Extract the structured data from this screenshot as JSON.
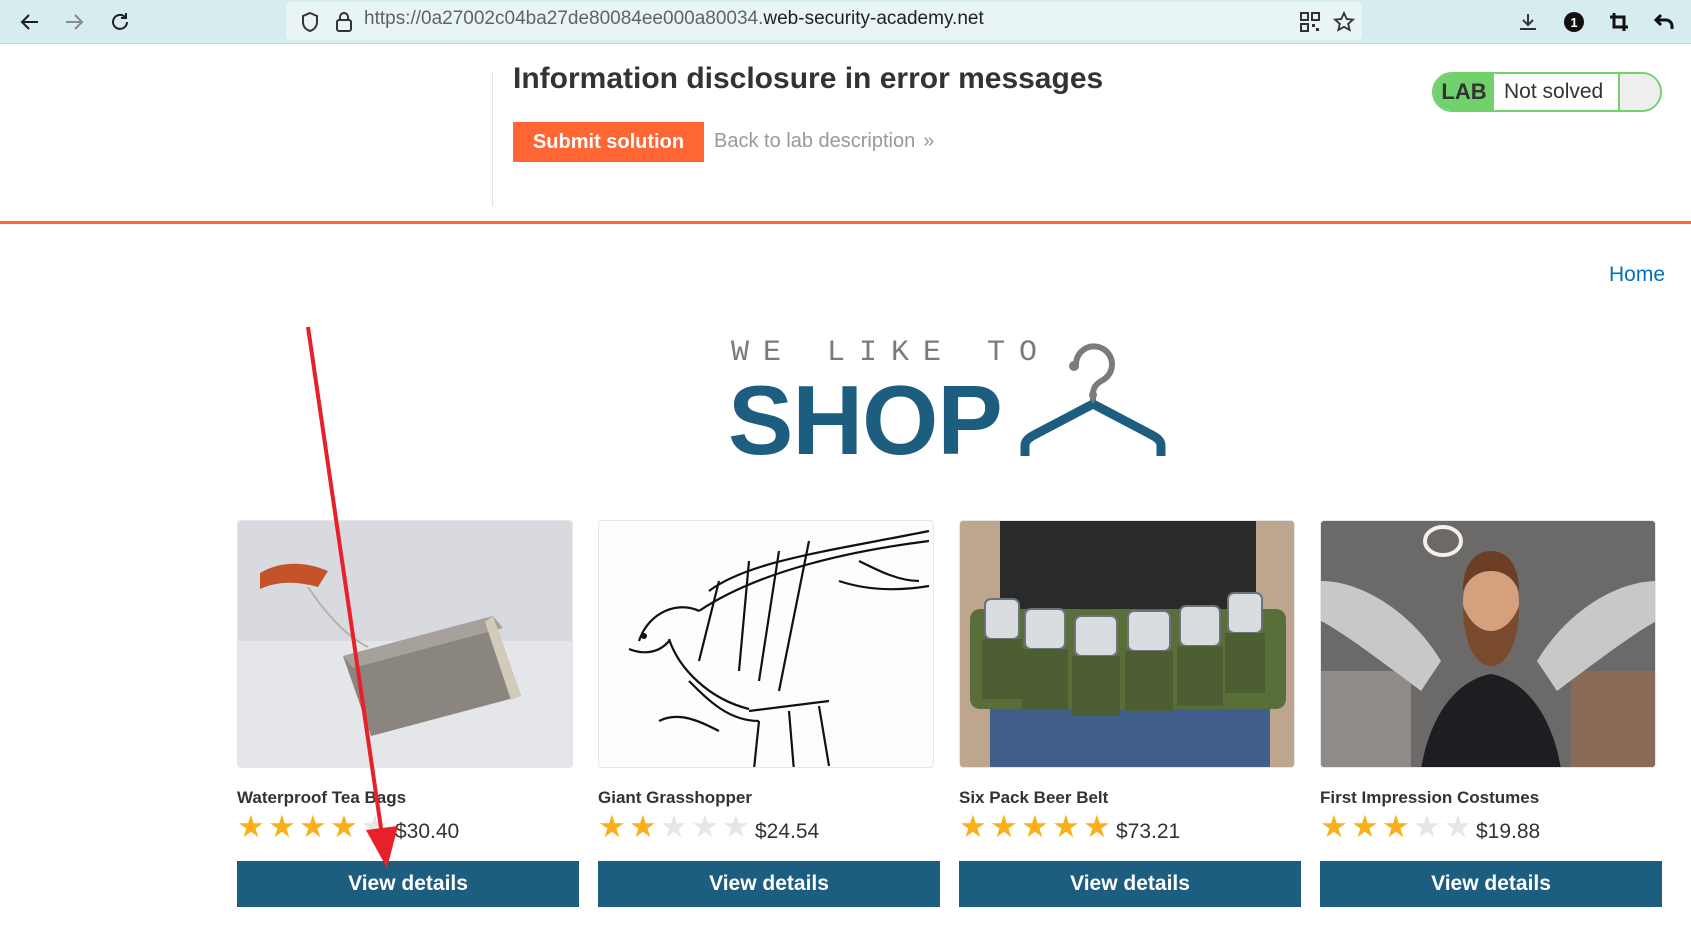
{
  "browser": {
    "url_prefix": "https://0a27002c04ba27de80084ee000a80034.",
    "url_host": "web-security-academy.net"
  },
  "lab": {
    "title": "Information disclosure in error messages",
    "submit_label": "Submit solution",
    "back_label": "Back to lab description",
    "back_chevron": "»",
    "status_badge": "LAB",
    "status_text": "Not solved"
  },
  "nav": {
    "home_label": "Home"
  },
  "logo": {
    "top_text": "WE LIKE TO",
    "main_text": "SHOP"
  },
  "products": [
    {
      "name": "Waterproof Tea Bags",
      "rating": 4,
      "price": "$30.40",
      "button": "View details"
    },
    {
      "name": "Giant Grasshopper",
      "rating": 2,
      "price": "$24.54",
      "button": "View details"
    },
    {
      "name": "Six Pack Beer Belt",
      "rating": 5,
      "price": "$73.21",
      "button": "View details"
    },
    {
      "name": "First Impression Costumes",
      "rating": 3,
      "price": "$19.88",
      "button": "View details"
    }
  ],
  "colors": {
    "accent_orange": "#ff6633",
    "brand_blue": "#1c5d80",
    "lab_green": "#70d16d",
    "annotation_red": "#e8202a"
  }
}
